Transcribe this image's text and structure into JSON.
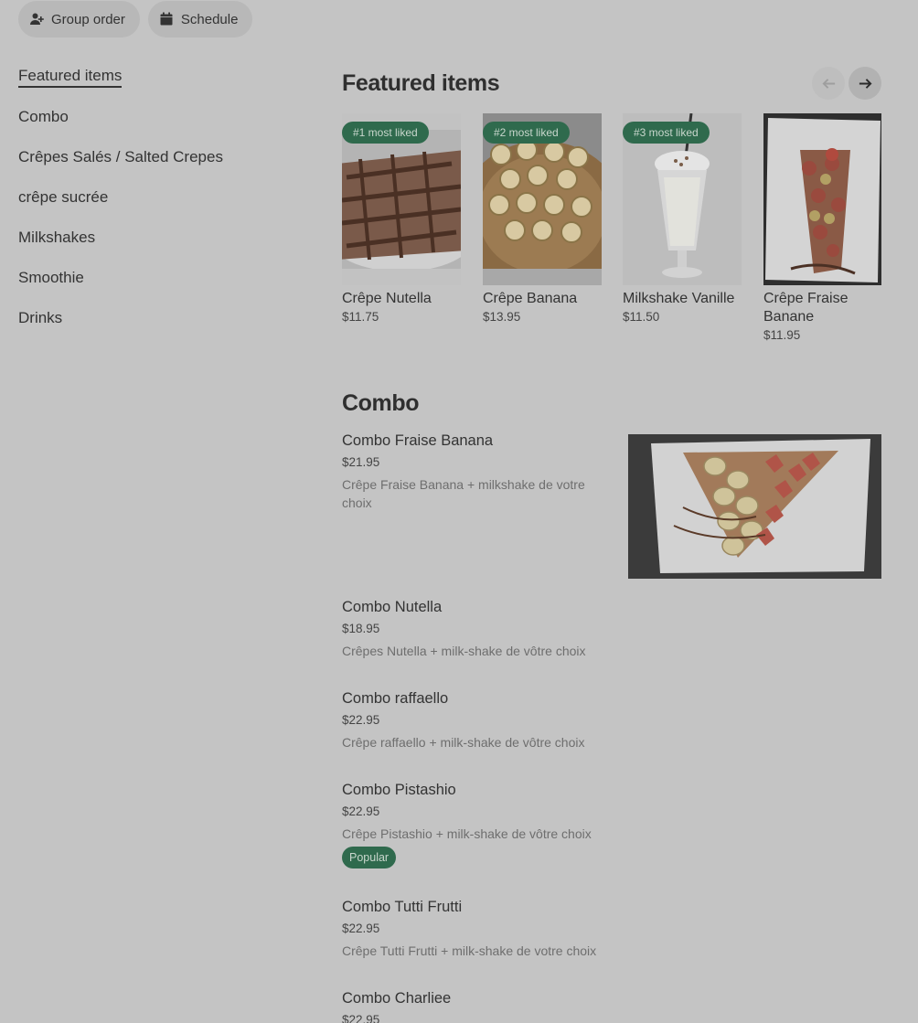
{
  "topbar": {
    "group_order": {
      "label": "Group order",
      "icon": "person-add-icon"
    },
    "schedule": {
      "label": "Schedule",
      "icon": "calendar-icon"
    }
  },
  "sidebar": {
    "items": [
      {
        "label": "Featured items",
        "active": true
      },
      {
        "label": "Combo"
      },
      {
        "label": "Crêpes Salés / Salted Crepes"
      },
      {
        "label": "crêpe sucrée"
      },
      {
        "label": "Milkshakes"
      },
      {
        "label": "Smoothie"
      },
      {
        "label": "Drinks"
      }
    ]
  },
  "featured": {
    "title": "Featured items",
    "prev_icon": "arrow-left-icon",
    "next_icon": "arrow-right-icon",
    "items": [
      {
        "badge": "#1 most liked",
        "name": "Crêpe Nutella",
        "price": "$11.75"
      },
      {
        "badge": "#2 most liked",
        "name": "Crêpe Banana",
        "price": "$13.95"
      },
      {
        "badge": "#3 most liked",
        "name": "Milkshake Vanille",
        "price": "$11.50"
      },
      {
        "badge": "",
        "name": "Crêpe Fraise Banane",
        "price": "$11.95"
      }
    ]
  },
  "combo": {
    "title": "Combo",
    "items": [
      {
        "name": "Combo Fraise Banana",
        "price": "$21.95",
        "desc": "Crêpe Fraise Banana + milkshake de votre choix"
      },
      {
        "name": "Combo Nutella",
        "price": "$18.95",
        "desc": "Crêpes Nutella + milk-shake de vôtre choix"
      },
      {
        "name": "Combo raffaello",
        "price": "$22.95",
        "desc": "Crêpe raffaello + milk-shake de vôtre choix"
      },
      {
        "name": "Combo Pistashio",
        "price": "$22.95",
        "desc": "Crêpe Pistashio + milk-shake de vôtre choix",
        "badge": "Popular"
      },
      {
        "name": "Combo Tutti Frutti",
        "price": "$22.95",
        "desc": "Crêpe Tutti Frutti + milk-shake de votre choix"
      },
      {
        "name": "Combo Charliee",
        "price": "$22.95",
        "desc": ""
      }
    ]
  },
  "colors": {
    "background": "#c4c4c4",
    "badge": "#2f6a4d",
    "text": "#2f2f2f"
  }
}
